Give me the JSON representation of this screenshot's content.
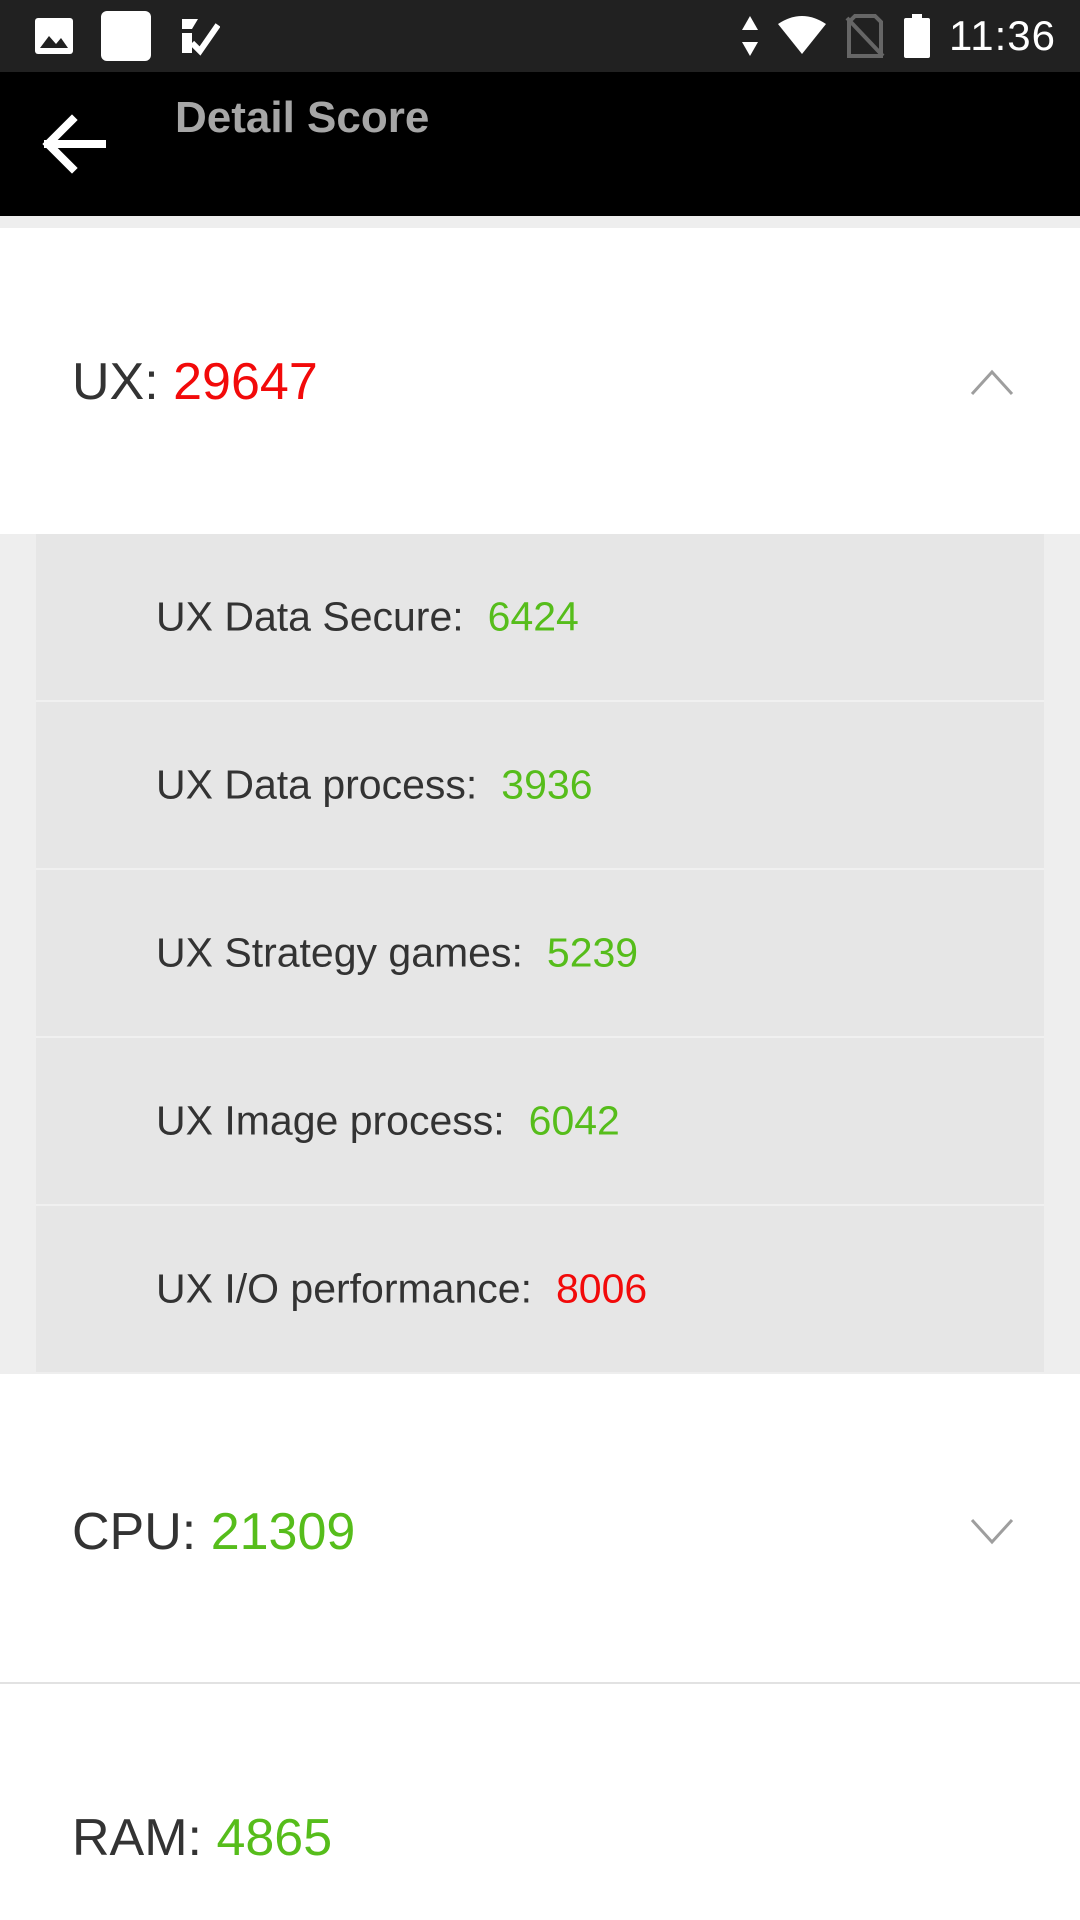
{
  "status_bar": {
    "time": "11:36",
    "left_icons": [
      "image-icon",
      "square-icon",
      "checkmark-notification-icon"
    ],
    "right_icons": [
      "data-arrows-icon",
      "wifi-icon",
      "no-sim-icon",
      "battery-icon"
    ]
  },
  "app_bar": {
    "title": "Detail Score",
    "back_icon": "arrow-left-icon"
  },
  "colors": {
    "good": "#56bd1b",
    "bad": "#f20a0a"
  },
  "sections": {
    "ux": {
      "name": "UX: ",
      "score": "29647",
      "score_color": "bad",
      "expanded": true,
      "items": [
        {
          "label": "UX Data Secure:",
          "value": "6424",
          "color": "good"
        },
        {
          "label": "UX Data process:",
          "value": "3936",
          "color": "good"
        },
        {
          "label": "UX Strategy games:",
          "value": "5239",
          "color": "good"
        },
        {
          "label": "UX Image process:",
          "value": "6042",
          "color": "good"
        },
        {
          "label": "UX I/O performance:",
          "value": "8006",
          "color": "bad"
        }
      ]
    },
    "cpu": {
      "name": "CPU: ",
      "score": "21309",
      "score_color": "good",
      "expanded": false
    },
    "ram": {
      "name": "RAM: ",
      "score": "4865",
      "score_color": "good"
    }
  }
}
